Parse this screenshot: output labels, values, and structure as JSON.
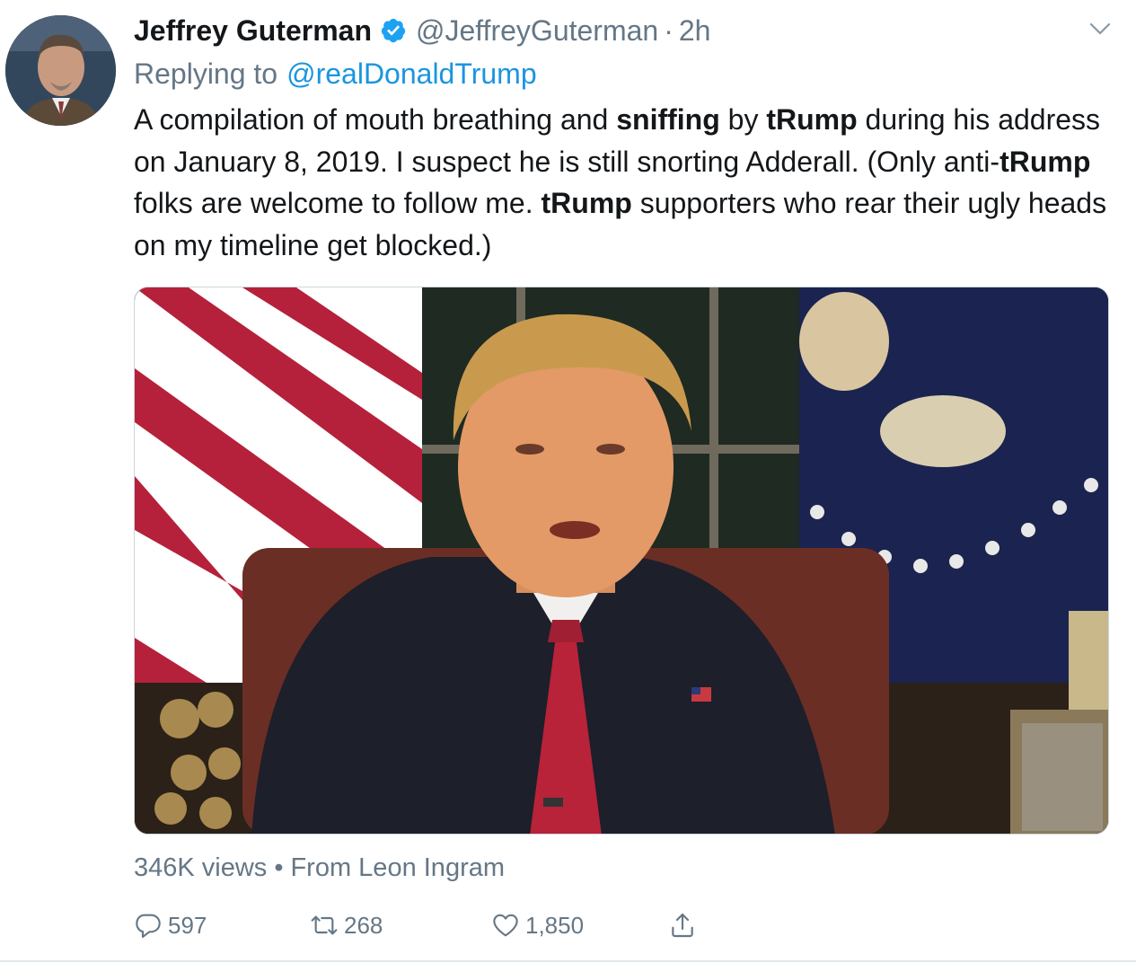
{
  "tweet": {
    "display_name": "Jeffrey Guterman",
    "handle": "@JeffreyGuterman",
    "separator": "·",
    "time": "2h",
    "replying_prefix": "Replying to",
    "replying_to": "@realDonaldTrump",
    "text_parts": [
      "A compilation of mouth breathing and ",
      "sniffing",
      " by ",
      "tRump",
      " during his address on January 8, 2019. I suspect he is still snorting Adderall. (Only anti-",
      "tRump",
      " folks are welcome to follow me. ",
      "tRump",
      " supporters who rear their ugly heads on my timeline get blocked.)"
    ],
    "views": "346K views",
    "views_separator": "•",
    "source": "From Leon Ingram",
    "replies": "597",
    "retweets": "268",
    "likes": "1,850"
  },
  "icons": {
    "verified": "verified-badge-icon",
    "menu": "chevron-down-icon",
    "reply": "reply-icon",
    "retweet": "retweet-icon",
    "like": "heart-icon",
    "share": "share-icon"
  },
  "colors": {
    "text": "#14171a",
    "secondary": "#657786",
    "link": "#1b95e0",
    "verified": "#1da1f2",
    "divider": "#e1e8ed"
  }
}
